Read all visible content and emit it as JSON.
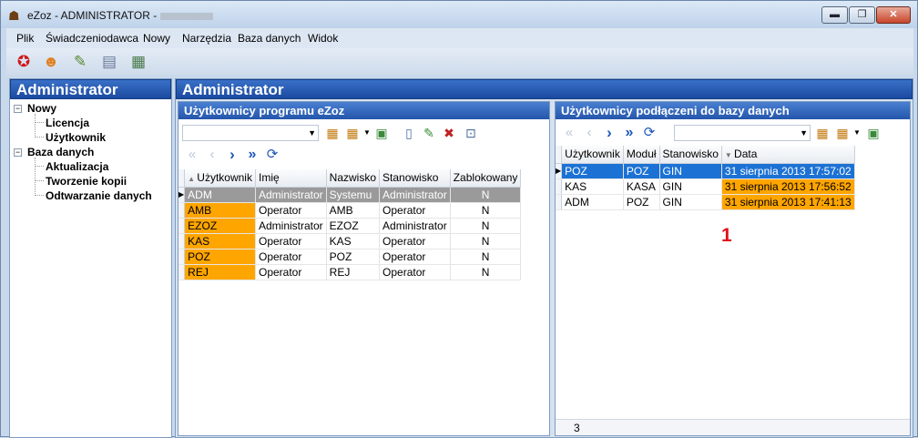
{
  "window": {
    "title": "eZoz - ADMINISTRATOR -",
    "min_label": "▬",
    "max_label": "❐",
    "close_label": "✕"
  },
  "menu": [
    "Plik",
    "Świadczeniodawca",
    "Nowy",
    "Narzędzia",
    "Baza danych",
    "Widok"
  ],
  "toolbar_icons": [
    "ribbon-award-icon",
    "user-icon",
    "pencil-edit-icon",
    "database-icon",
    "database-refresh-icon"
  ],
  "left": {
    "title": "Administrator",
    "tree": {
      "nowy": "Nowy",
      "licencja": "Licencja",
      "uzytkownik": "Użytkownik",
      "baza": "Baza danych",
      "aktualizacja": "Aktualizacja",
      "tworzenie": "Tworzenie kopii",
      "odtwarzanie": "Odtwarzanie danych"
    }
  },
  "main": {
    "title": "Administrator",
    "users": {
      "title": "Użytkownicy programu eZoz",
      "columns": [
        "Użytkownik",
        "Imię",
        "Nazwisko",
        "Stanowisko",
        "Zablokowany"
      ],
      "rows": [
        [
          "ADM",
          "Administrator",
          "Systemu",
          "Administrator",
          "N"
        ],
        [
          "AMB",
          "Operator",
          "AMB",
          "Operator",
          "N"
        ],
        [
          "EZOZ",
          "Administrator",
          "EZOZ",
          "Administrator",
          "N"
        ],
        [
          "KAS",
          "Operator",
          "KAS",
          "Operator",
          "N"
        ],
        [
          "POZ",
          "Operator",
          "POZ",
          "Operator",
          "N"
        ],
        [
          "REJ",
          "Operator",
          "REJ",
          "Operator",
          "N"
        ]
      ]
    },
    "connected": {
      "title": "Użytkownicy podłączeni do bazy danych",
      "columns": [
        "Użytkownik",
        "Moduł",
        "Stanowisko",
        "Data"
      ],
      "rows": [
        [
          "POZ",
          "POZ",
          "GIN",
          "31 sierpnia 2013 17:57:02"
        ],
        [
          "KAS",
          "KASA",
          "GIN",
          "31 sierpnia 2013 17:56:52"
        ],
        [
          "ADM",
          "POZ",
          "GIN",
          "31 sierpnia 2013 17:41:13"
        ]
      ],
      "count": "3"
    },
    "annotation": "1"
  },
  "colors": {
    "highlight_orange": "#ffa500",
    "selected_blue": "#1c72d4",
    "annotation_red": "#e0101a"
  }
}
